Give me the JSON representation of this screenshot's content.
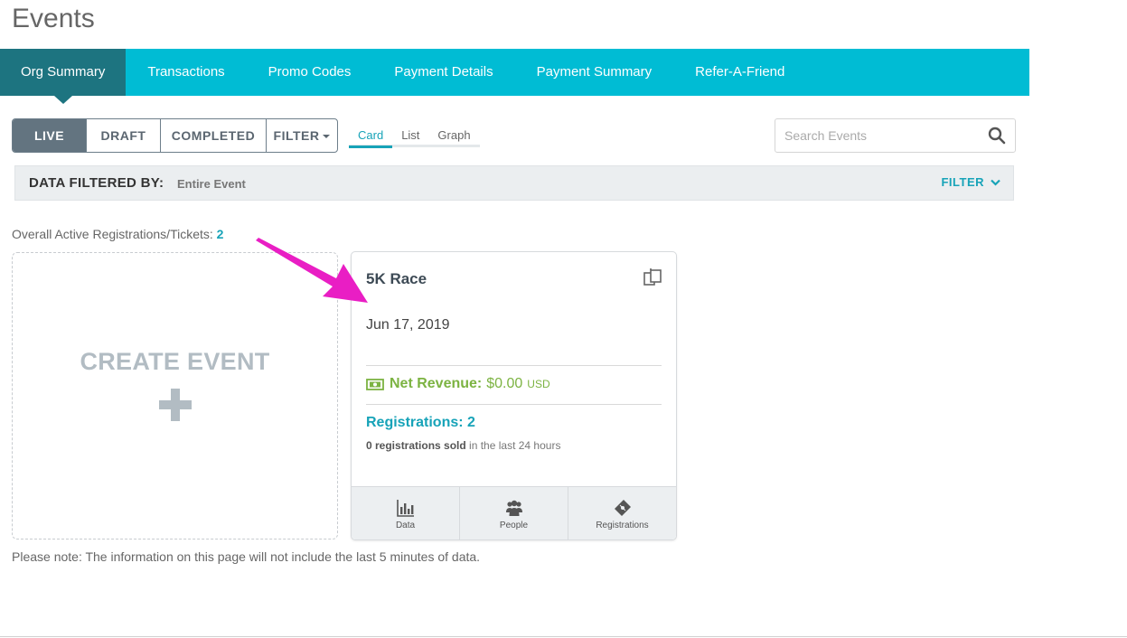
{
  "page": {
    "title": "Events"
  },
  "nav": {
    "items": [
      {
        "label": "Org Summary",
        "active": true
      },
      {
        "label": "Transactions",
        "active": false
      },
      {
        "label": "Promo Codes",
        "active": false
      },
      {
        "label": "Payment Details",
        "active": false
      },
      {
        "label": "Payment Summary",
        "active": false
      },
      {
        "label": "Refer-A-Friend",
        "active": false
      }
    ]
  },
  "status_filter": {
    "live": "LIVE",
    "draft": "DRAFT",
    "completed": "COMPLETED",
    "filter": "FILTER"
  },
  "views": {
    "card": "Card",
    "list": "List",
    "graph": "Graph",
    "selected": "Card"
  },
  "search": {
    "placeholder": "Search Events",
    "value": ""
  },
  "filter_bar": {
    "label": "DATA FILTERED BY:",
    "value": "Entire Event",
    "filter_label": "FILTER"
  },
  "summary": {
    "label": "Overall Active Registrations/Tickets:",
    "count": "2"
  },
  "create_event": {
    "label": "CREATE EVENT"
  },
  "event_card": {
    "title": "5K Race",
    "date": "Jun 17, 2019",
    "net_revenue_label": "Net Revenue:",
    "net_revenue_value": "$0.00",
    "currency": "USD",
    "registrations_label": "Registrations: 2",
    "sold_count": "0 registrations sold",
    "sold_suffix": "in the last 24 hours",
    "footer": {
      "data": "Data",
      "people": "People",
      "registrations": "Registrations"
    }
  },
  "note": "Please note: The information on this page will not include the last 5 minutes of data.",
  "colors": {
    "nav_bg": "#00bcd4",
    "nav_active": "#1d7480",
    "accent": "#17a3b8",
    "revenue_green": "#7cb342",
    "annotation_arrow": "#e91ec4"
  }
}
